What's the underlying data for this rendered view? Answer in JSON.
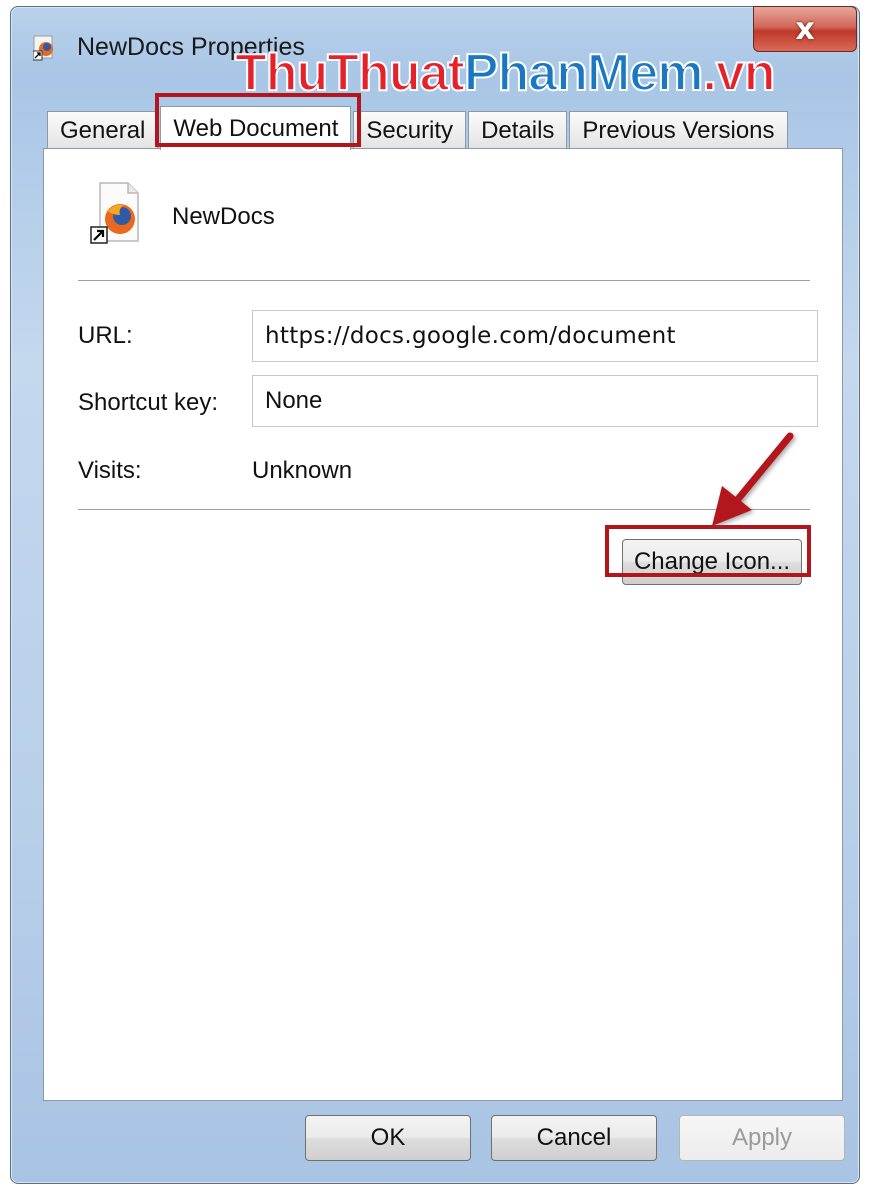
{
  "window": {
    "title": "NewDocs Properties",
    "close_glyph": "x"
  },
  "watermark": {
    "part1": "ThuThuat",
    "part2": "PhanMem",
    "part3": ".vn"
  },
  "tabs": [
    {
      "label": "General",
      "active": false
    },
    {
      "label": "Web Document",
      "active": true
    },
    {
      "label": "Security",
      "active": false
    },
    {
      "label": "Details",
      "active": false
    },
    {
      "label": "Previous Versions",
      "active": false
    }
  ],
  "document": {
    "name": "NewDocs",
    "icon": "firefox-shortcut-icon"
  },
  "fields": {
    "url_label": "URL:",
    "url_value": "https://docs.google.com/document",
    "shortcut_label": "Shortcut key:",
    "shortcut_value": "None",
    "visits_label": "Visits:",
    "visits_value": "Unknown"
  },
  "buttons": {
    "change_icon": "Change Icon...",
    "ok": "OK",
    "cancel": "Cancel",
    "apply": "Apply"
  },
  "colors": {
    "highlight": "#b3151d",
    "watermark_red": "#e4222a",
    "watermark_blue": "#1a78c2"
  }
}
